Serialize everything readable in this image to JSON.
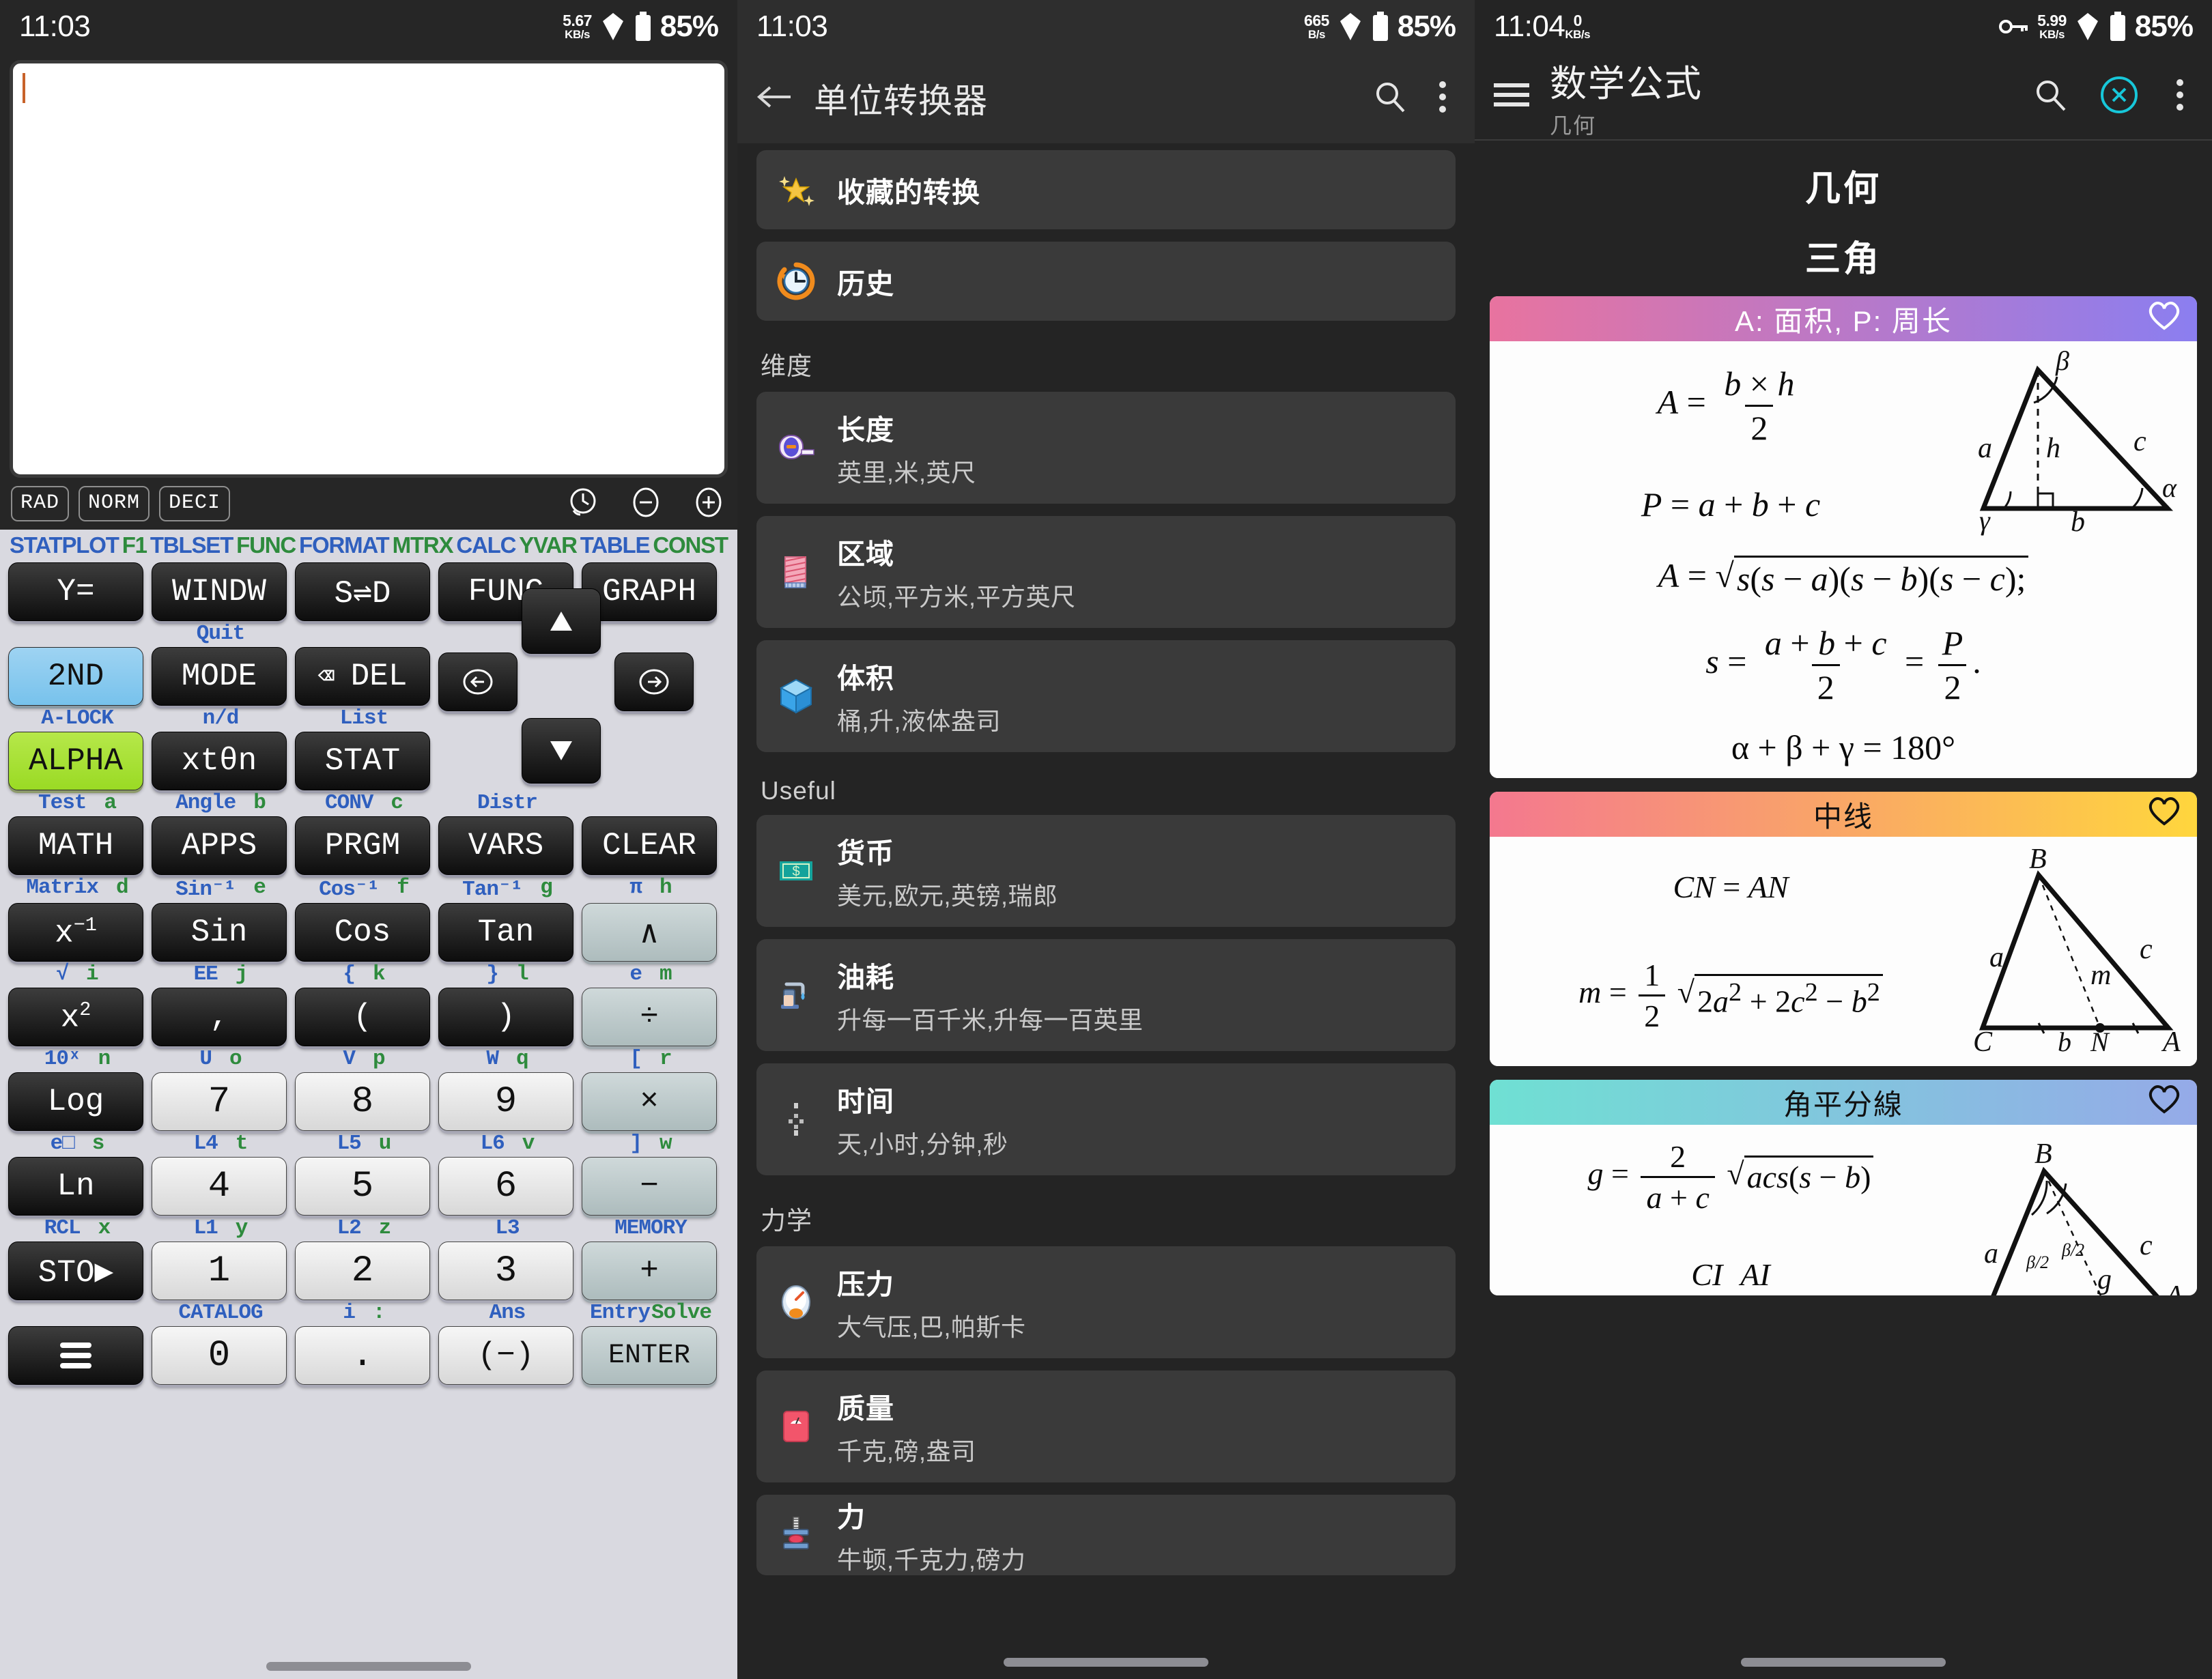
{
  "panel1": {
    "status": {
      "time": "11:03",
      "net_speed": "5.67",
      "net_unit": "KB/s",
      "battery": "85%"
    },
    "display": {
      "value": ""
    },
    "mode_chips": [
      "RAD",
      "NORM",
      "DECI"
    ],
    "fn_row": [
      {
        "text": "STATPLOT",
        "color": "blue"
      },
      {
        "text": "F1",
        "color": "green"
      },
      {
        "text": "TBLSET",
        "color": "blue"
      },
      {
        "text": "FUNC",
        "color": "green"
      },
      {
        "text": "FORMAT",
        "color": "blue"
      },
      {
        "text": "MTRX",
        "color": "green"
      },
      {
        "text": "CALC",
        "color": "blue"
      },
      {
        "text": "YVAR",
        "color": "green"
      },
      {
        "text": "TABLE",
        "color": "blue"
      },
      {
        "text": "CONST",
        "color": "green"
      }
    ],
    "rows": [
      {
        "keys": [
          "Y=",
          "WINDW",
          "S⇌D",
          "FUNC",
          "GRAPH"
        ],
        "sub": [
          {},
          {
            "blue": "Quit"
          },
          {},
          {},
          {}
        ]
      },
      {
        "keys": [
          "2ND",
          "MODE",
          "DEL"
        ],
        "sub": [
          {
            "blue": "A-LOCK"
          },
          {
            "blue": "n/d"
          },
          {
            "blue": "List"
          }
        ]
      },
      {
        "keys": [
          "ALPHA",
          "xtθn",
          "STAT"
        ],
        "sub": [
          {
            "blue": "Test",
            "green": "a"
          },
          {
            "blue": "Angle",
            "green": "b"
          },
          {
            "blue": "CONV",
            "green": "c"
          },
          {
            "blue": "Distr"
          }
        ]
      },
      {
        "keys": [
          "MATH",
          "APPS",
          "PRGM",
          "VARS",
          "CLEAR"
        ],
        "sub": [
          {
            "blue": "Matrix",
            "green": "d"
          },
          {
            "blue": "Sin⁻¹",
            "green": "e"
          },
          {
            "blue": "Cos⁻¹",
            "green": "f"
          },
          {
            "blue": "Tan⁻¹",
            "green": "g"
          },
          {
            "blue": "π",
            "green": "h"
          }
        ]
      },
      {
        "keys": [
          "x⁻¹",
          "Sin",
          "Cos",
          "Tan",
          "∧"
        ],
        "sub": [
          {
            "blue": "√",
            "green": "i"
          },
          {
            "blue": "EE",
            "green": "j"
          },
          {
            "blue": "{",
            "green": "k"
          },
          {
            "blue": "}",
            "green": "l"
          },
          {
            "blue": "e",
            "green": "m"
          }
        ]
      },
      {
        "keys": [
          "x²",
          ",",
          "(",
          ")",
          "÷"
        ],
        "sub": [
          {
            "blue": "10ˣ",
            "green": "n"
          },
          {
            "blue": "U",
            "green": "o"
          },
          {
            "blue": "V",
            "green": "p"
          },
          {
            "blue": "W",
            "green": "q"
          },
          {
            "blue": "[",
            "green": "r"
          }
        ]
      },
      {
        "keys": [
          "Log",
          "7",
          "8",
          "9",
          "×"
        ],
        "sub": [
          {
            "blue": "e□",
            "green": "s"
          },
          {
            "blue": "L4",
            "green": "t"
          },
          {
            "blue": "L5",
            "green": "u"
          },
          {
            "blue": "L6",
            "green": "v"
          },
          {
            "blue": "]",
            "green": "w"
          }
        ]
      },
      {
        "keys": [
          "Ln",
          "4",
          "5",
          "6",
          "−"
        ],
        "sub": [
          {
            "blue": "RCL",
            "green": "x"
          },
          {
            "blue": "L1",
            "green": "y"
          },
          {
            "blue": "L2",
            "green": "z"
          },
          {
            "blue": "L3"
          },
          {
            "blue": "MEMORY"
          }
        ]
      },
      {
        "keys": [
          "STO▶",
          "1",
          "2",
          "3",
          "+"
        ],
        "sub": [
          {},
          {
            "blue": "CATALOG"
          },
          {
            "blue": "i",
            "green": ":"
          },
          {
            "blue": "Ans"
          },
          {
            "blue": "Entry",
            "green": "Solve"
          }
        ]
      },
      {
        "keys": [
          "≡",
          "0",
          ".",
          "(−)",
          "ENTER"
        ],
        "sub": []
      }
    ],
    "nav": {
      "up": "up-arrow",
      "down": "down-arrow",
      "left": "left-arrow",
      "right": "right-arrow"
    }
  },
  "panel2": {
    "status": {
      "time": "11:03",
      "net_speed": "665",
      "net_unit": "B/s",
      "battery": "85%"
    },
    "appbar": {
      "title": "单位转换器",
      "back": "back-arrow",
      "search": "search-icon",
      "overflow": "more-vert-icon"
    },
    "quick": [
      {
        "title": "收藏的转换",
        "icon": "sparkle-star"
      },
      {
        "title": "历史",
        "icon": "history-clock"
      }
    ],
    "sections": [
      {
        "heading": "维度",
        "items": [
          {
            "title": "长度",
            "sub": "英里,米,英尺",
            "icon": "tape-measure"
          },
          {
            "title": "区域",
            "sub": "公顷,平方米,平方英尺",
            "icon": "area-rug"
          },
          {
            "title": "体积",
            "sub": "桶,升,液体盎司",
            "icon": "cube"
          }
        ]
      },
      {
        "heading": "Useful",
        "items": [
          {
            "title": "货币",
            "sub": "美元,欧元,英镑,瑞郎",
            "icon": "banknote"
          },
          {
            "title": "油耗",
            "sub": "升每一百千米,升每一百英里",
            "icon": "fuel-pump"
          },
          {
            "title": "时间",
            "sub": "天,小时,分钟,秒",
            "icon": "time-dots"
          }
        ]
      },
      {
        "heading": "力学",
        "items": [
          {
            "title": "压力",
            "sub": "大气压,巴,帕斯卡",
            "icon": "gauge"
          },
          {
            "title": "质量",
            "sub": "千克,磅,盎司",
            "icon": "scale"
          },
          {
            "title": "力",
            "sub": "牛顿,千克力,磅力",
            "icon": "press"
          }
        ]
      }
    ]
  },
  "panel3": {
    "status": {
      "time": "11:04",
      "net_speed": "0",
      "net_unit": "KB/s",
      "net_speed_right": "5.99",
      "net_unit_right": "KB/s",
      "battery": "85%"
    },
    "appbar": {
      "menu": "hamburger-icon",
      "title": "数学公式",
      "subtitle": "几何",
      "search": "search-icon",
      "close": "close-circle-icon",
      "overflow": "more-vert-icon",
      "close_color": "#17c7d9"
    },
    "category": "几何",
    "subcategory": "三角",
    "cards": [
      {
        "title": "A: 面积, P: 周长",
        "gradient_from": "#e8739f",
        "gradient_to": "#8b7ef0",
        "title_color": "#ffffff",
        "heart": "heart-outline",
        "formulas": [
          "A = (b × h) / 2",
          "P = a + b + c",
          "A = √(s(s−a)(s−b)(s−c));",
          "s = (a+b+c)/2 = P/2,",
          "α + β + γ = 180°"
        ],
        "diagram": "triangle-with-height",
        "diagram_labels": [
          "α",
          "β",
          "γ",
          "a",
          "b",
          "c",
          "h"
        ]
      },
      {
        "title": "中线",
        "gradient_from": "#f4788f",
        "gradient_to": "#ffd63d",
        "title_color": "#111111",
        "heart": "heart-outline",
        "formulas": [
          "CN = AN",
          "m = (1/2)√(2a² + 2c² − b²)"
        ],
        "diagram": "triangle-with-median",
        "diagram_labels": [
          "A",
          "B",
          "C",
          "N",
          "a",
          "b",
          "c",
          "m"
        ]
      },
      {
        "title": "角平分線",
        "gradient_from": "#6fe0d3",
        "gradient_to": "#95aae8",
        "title_color": "#111111",
        "heart": "heart-outline",
        "formulas": [
          "g = (2/(a+c))√(acs(s−b))",
          "CI / AI"
        ],
        "diagram": "triangle-with-bisector",
        "diagram_labels": [
          "A",
          "B",
          "a",
          "c",
          "g",
          "β/2",
          "β/2"
        ]
      }
    ]
  }
}
